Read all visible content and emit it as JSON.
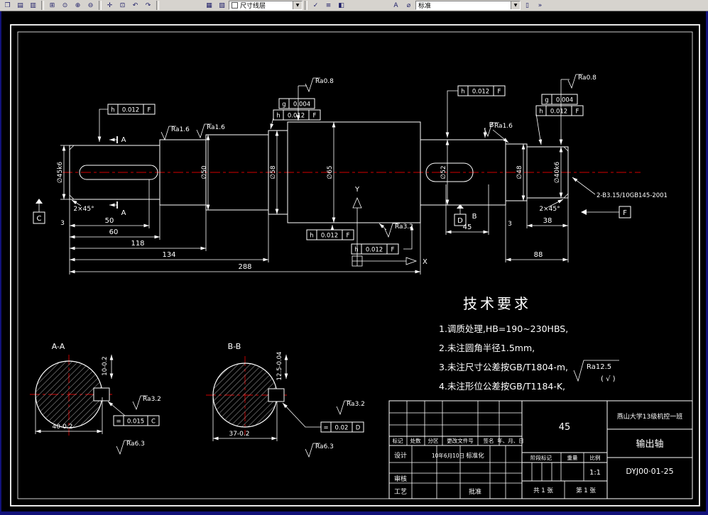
{
  "colors": {
    "background": "#000000",
    "line_color": "#ffffff",
    "centerline_color": "#d40000",
    "toolbar_bg": "#d6d3ce"
  },
  "toolbar": {
    "layer_combo": {
      "value": "尺寸线层",
      "arrow": "▼"
    },
    "style_combo": {
      "value": "标准",
      "arrow": "▼"
    },
    "icons": [
      {
        "name": "open-icon",
        "glyph": "❒"
      },
      {
        "name": "layout-icon",
        "glyph": "▤"
      },
      {
        "name": "plot-icon",
        "glyph": "▥"
      },
      {
        "name": "zoom-window-icon",
        "glyph": "⊞"
      },
      {
        "name": "zoom-dynamic-icon",
        "glyph": "⊙"
      },
      {
        "name": "zoom-in-icon",
        "glyph": "⊕"
      },
      {
        "name": "zoom-out-icon",
        "glyph": "⊖"
      },
      {
        "name": "pan-icon",
        "glyph": "✛"
      },
      {
        "name": "zoom-extents-icon",
        "glyph": "⊡"
      },
      {
        "name": "undo-icon",
        "glyph": "↶"
      },
      {
        "name": "redo-icon",
        "glyph": "↷"
      },
      {
        "name": "layers-icon",
        "glyph": "▦"
      },
      {
        "name": "layer-states-icon",
        "glyph": "▧"
      },
      {
        "name": "make-current-icon",
        "glyph": "✓"
      },
      {
        "name": "match-properties-icon",
        "glyph": "≡"
      },
      {
        "name": "color-control-icon",
        "glyph": "◧"
      },
      {
        "name": "text-style-icon",
        "glyph": "A"
      },
      {
        "name": "dim-style-icon",
        "glyph": "⌀"
      },
      {
        "name": "table-style-icon",
        "glyph": "▯"
      },
      {
        "name": "more-icon",
        "glyph": "»"
      }
    ]
  },
  "main_view": {
    "finish": {
      "f1": "Ra0.8",
      "f2": "Ra1.6",
      "f3": "Ra1.6",
      "f4": "Ra0.8",
      "f5": "Ra1.6",
      "f6": "Ra3.2"
    },
    "frames": {
      "t1": {
        "sym": "h",
        "val": "0.012",
        "ref": "F"
      },
      "t2": {
        "sym": "g",
        "val": "0.004"
      },
      "t3": {
        "sym": "h",
        "val": "0.012",
        "ref": "F"
      },
      "t4": {
        "sym": "h",
        "val": "0.012",
        "ref": "F"
      },
      "t5": {
        "sym": "g",
        "val": "0.004"
      },
      "t6": {
        "sym": "h",
        "val": "0.012",
        "ref": "F"
      },
      "t7": {
        "sym": "h",
        "val": "0.012",
        "ref": "F"
      },
      "t8": {
        "sym": "h",
        "val": "0.012",
        "ref": "F"
      }
    },
    "datums": {
      "a": "A",
      "b": "B",
      "c": "C",
      "d": "D",
      "f": "F"
    },
    "chamfer_left": "2×45°",
    "chamfer_right": "2×45°",
    "center_hole_note": "2-B3.15/10GB145-2001",
    "dims": {
      "d3l": "3",
      "d50": "50",
      "d60": "60",
      "d118": "118",
      "d134": "134",
      "d288": "288",
      "d45": "45",
      "d3r": "3",
      "d38": "38",
      "d88": "88"
    },
    "dia": {
      "s1": "∅45k6",
      "s3": "∅50",
      "s4": "∅58",
      "s5": "∅65",
      "s6": "∅52",
      "s7": "∅48",
      "s8": "∅40k6"
    },
    "ucs": {
      "x": "X",
      "y": "Y"
    }
  },
  "section_a": {
    "label": "A-A",
    "finish_top": "Ra3.2",
    "finish_bottom": "Ra6.3",
    "dim_bottom": "40-0.2",
    "dim_side": "10-0.2",
    "frame": {
      "sym": "=",
      "val": "0.015",
      "ref": "C"
    }
  },
  "section_b": {
    "label": "B-B",
    "finish_top": "Ra3.2",
    "finish_bottom": "Ra6.3",
    "dim_bottom": "37-0.2",
    "dim_side": "12.5-0.04",
    "frame": {
      "sym": "=",
      "val": "0.02",
      "ref": "D"
    }
  },
  "tech_req": {
    "title": "技术要求",
    "items": [
      "1.调质处理,HB=190~230HBS,",
      "2.未注圆角半径1.5mm,",
      "3.未注尺寸公差按GB/T1804-m,",
      "4.未注形位公差按GB/T1184-K,"
    ]
  },
  "other_finish": {
    "label": "Ra12.5",
    "suffix": "( √ )"
  },
  "title_block": {
    "material": "45",
    "school": "燕山大学13级机控一班",
    "part_name": "输出轴",
    "drawing_no": "DYJ00·01-25",
    "stage_label": "阶段标记",
    "weight_label": "重量",
    "scale_label": "比例",
    "scale": "1:1",
    "sheets": "共 1 张",
    "sheet_no": "第 1 张",
    "rev_headers": [
      "标记",
      "处数",
      "分区",
      "更改文件号",
      "签名",
      "年、月、日"
    ],
    "roles": {
      "design": "设计",
      "check": "审核",
      "process": "工艺",
      "standard": "标准化",
      "approve": "批准"
    },
    "design_date": "10年6月10日"
  }
}
